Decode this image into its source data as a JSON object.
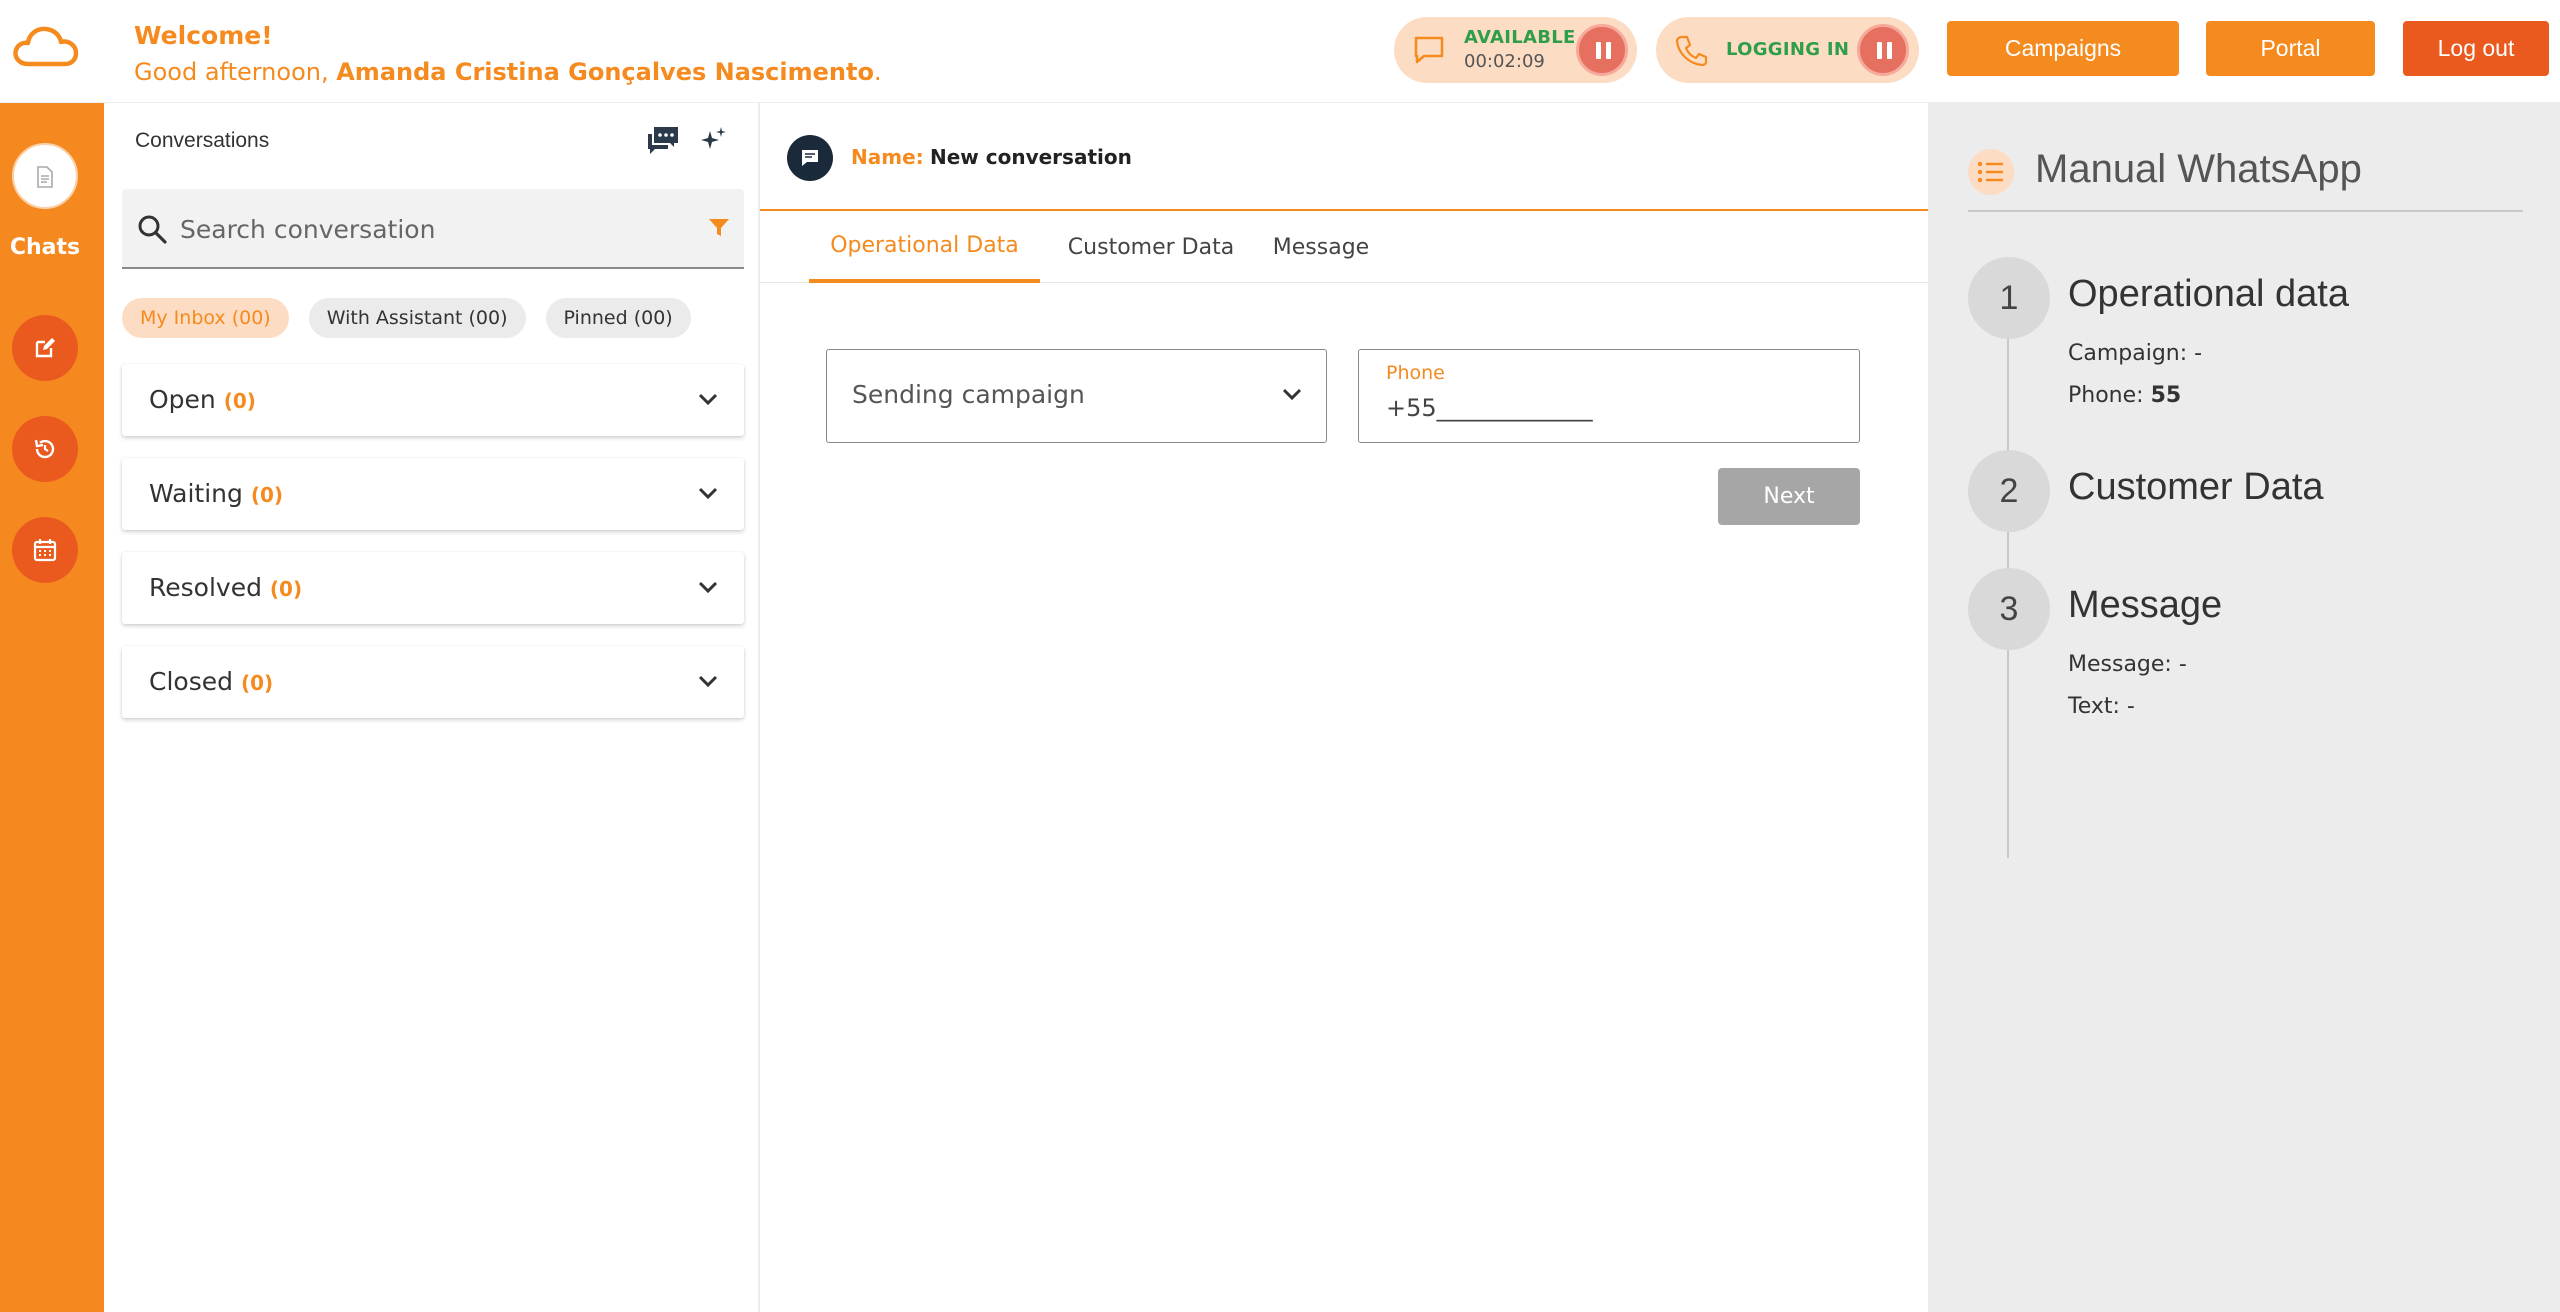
{
  "header": {
    "welcome_title": "Welcome!",
    "greeting_prefix": "Good afternoon, ",
    "user_name": "Amanda Cristina Gonçalves Nascimento",
    "greeting_suffix": ".",
    "status_available": {
      "label": "AVAILABLE",
      "timer": "00:02:09"
    },
    "status_phone": {
      "label": "LOGGING IN"
    },
    "buttons": {
      "campaigns": "Campaigns",
      "portal": "Portal",
      "logout": "Log out"
    }
  },
  "sidebar": {
    "active_label": "Chats",
    "items": [
      "chats-icon",
      "compose-icon",
      "history-icon",
      "calendar-icon"
    ]
  },
  "conversations": {
    "title": "Conversations",
    "search_placeholder": "Search conversation",
    "chips": [
      "My Inbox (00)",
      "With Assistant (00)",
      "Pinned (00)"
    ],
    "sections": [
      {
        "label": "Open",
        "count": "(0)"
      },
      {
        "label": "Waiting",
        "count": "(0)"
      },
      {
        "label": "Resolved",
        "count": "(0)"
      },
      {
        "label": "Closed",
        "count": "(0)"
      }
    ]
  },
  "conversation": {
    "name_key": "Name:",
    "name_value": "New conversation",
    "tabs": [
      "Operational Data",
      "Customer Data",
      "Message"
    ],
    "active_tab": 0,
    "form": {
      "campaign_select": "Sending campaign",
      "phone_label": "Phone",
      "phone_value": "+55_____________",
      "next_button": "Next"
    }
  },
  "stepper": {
    "title": "Manual WhatsApp",
    "steps": [
      {
        "num": "1",
        "title": "Operational data",
        "details": [
          {
            "key": "Campaign:",
            "value": "-"
          },
          {
            "key": "Phone:",
            "value": "55"
          }
        ]
      },
      {
        "num": "2",
        "title": "Customer Data",
        "details": []
      },
      {
        "num": "3",
        "title": "Message",
        "details": [
          {
            "key": "Message:",
            "value": "-"
          },
          {
            "key": "Text:",
            "value": "-"
          }
        ]
      }
    ]
  },
  "colors": {
    "brand_orange": "#f58a1f",
    "accent_red": "#ea5a1e",
    "status_green": "#2e9e4a",
    "pill_bg": "#fcdcc3"
  }
}
